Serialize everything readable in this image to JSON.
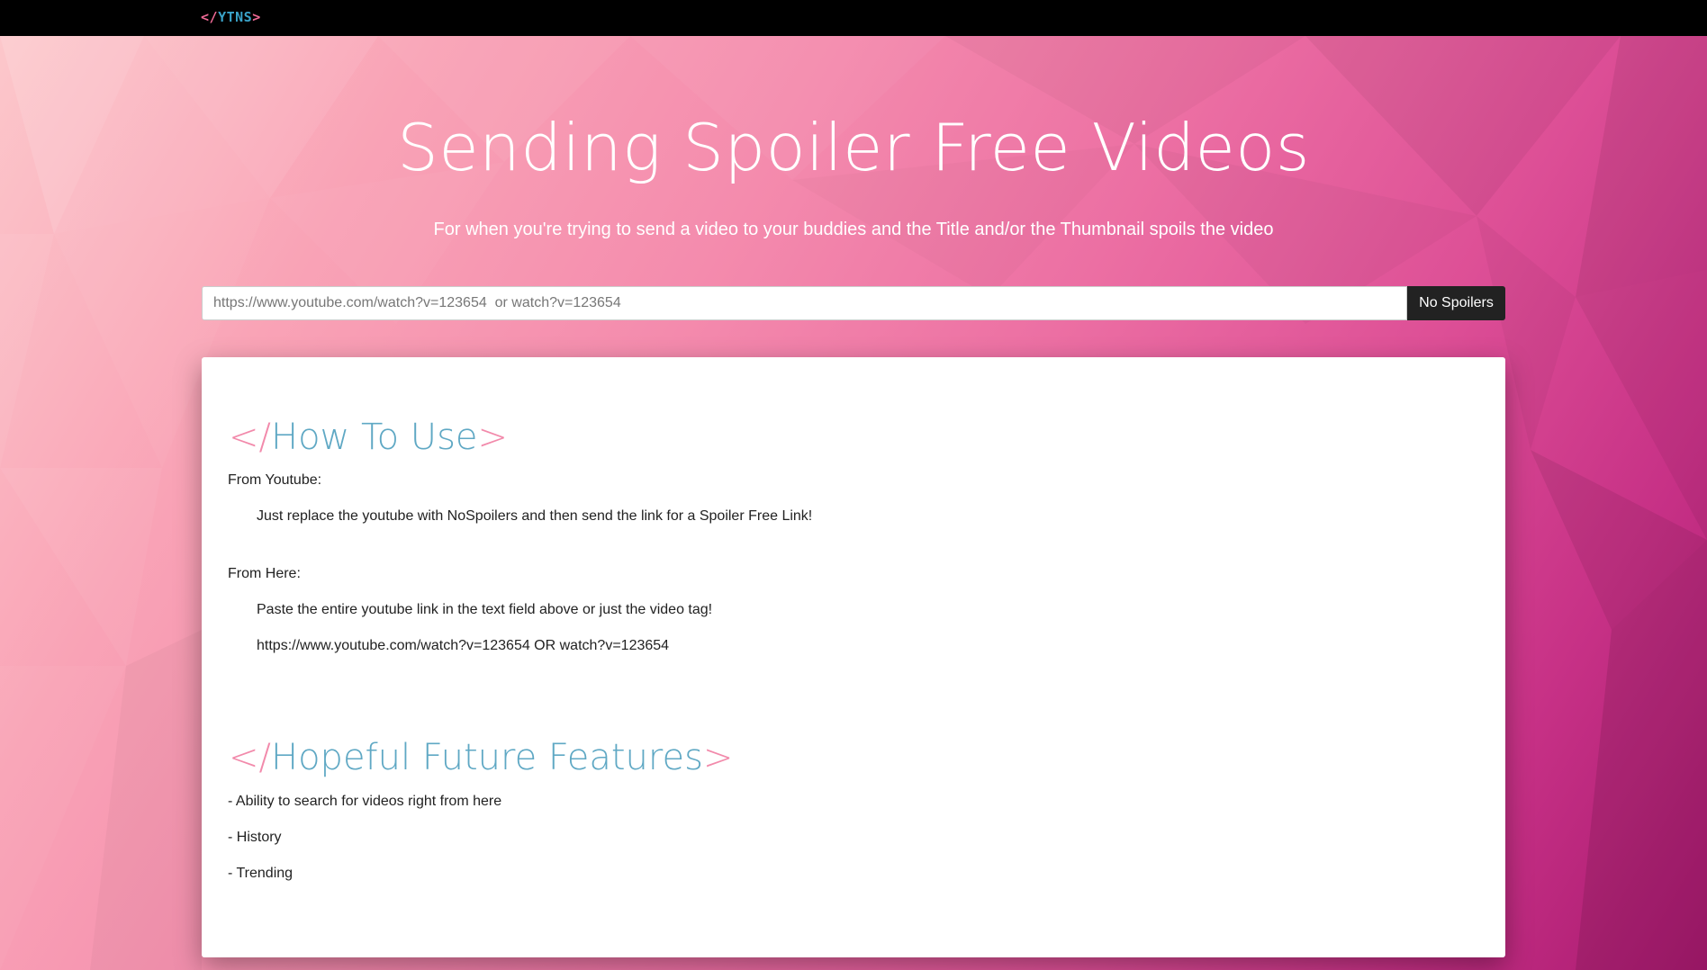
{
  "navbar": {
    "brand_open": "</",
    "brand_name": "YTNS",
    "brand_close": ">"
  },
  "hero": {
    "title": "Sending Spoiler Free Videos",
    "subtitle": "For when you're trying to send a video to your buddies and the Title and/or the Thumbnail spoils the video"
  },
  "search": {
    "placeholder": "https://www.youtube.com/watch?v=123654  or watch?v=123654",
    "value": "",
    "button_label": "No Spoilers"
  },
  "how_to_use": {
    "tag_open": "</",
    "title": "How To Use",
    "tag_close": ">",
    "from_youtube_label": "From Youtube:",
    "from_youtube_text": "Just replace the youtube with NoSpoilers and then send the link for a Spoiler Free Link!",
    "from_here_label": "From Here:",
    "from_here_text": "Paste the entire youtube link in the text field above or just the video tag!",
    "example": "https://www.youtube.com/watch?v=123654 OR watch?v=123654"
  },
  "future_features": {
    "tag_open": "</",
    "title": "Hopeful Future Features",
    "tag_close": ">",
    "items": [
      "- Ability to search for videos right from here",
      "- History",
      "- Trending"
    ]
  },
  "colors": {
    "navbar_bg": "#000000",
    "brand_bracket": "#f06a96",
    "brand_name": "#3aa3c9",
    "heading_tag": "#f28aab",
    "heading_text": "#5fa8c4",
    "button_bg": "#222222"
  }
}
